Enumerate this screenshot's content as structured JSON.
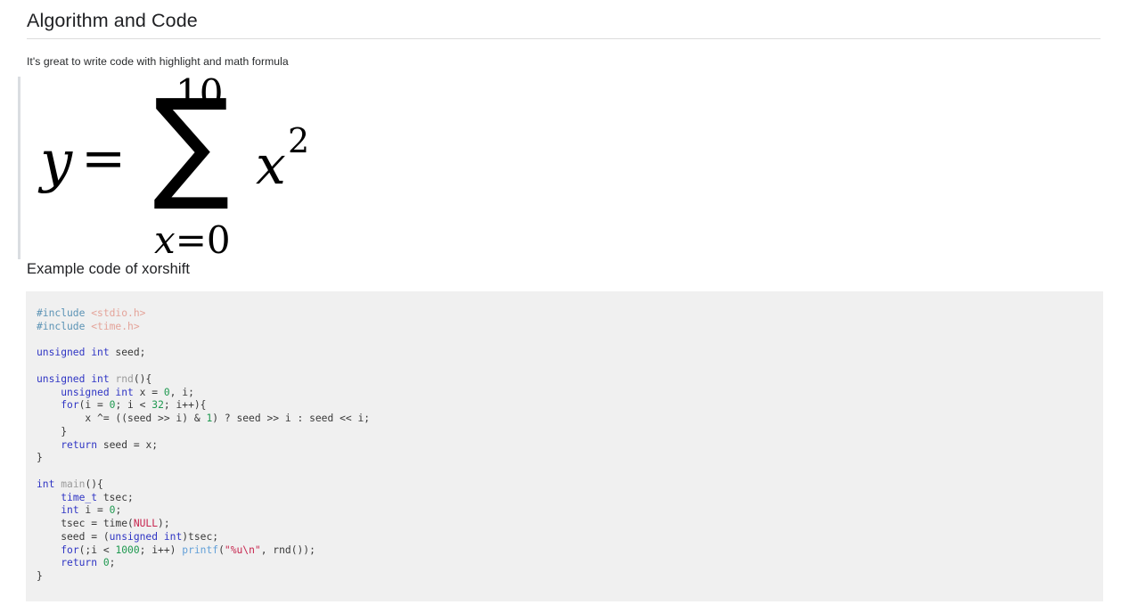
{
  "document": {
    "title": "Algorithm and Code",
    "intro": "It's great to write code with highlight and math formula",
    "sub_heading": "Example code of xorshift"
  },
  "formula": {
    "latex": "y = \\sum_{x=0}^{10} x^2",
    "plain": "y = sum from x=0 to 10 of x^2",
    "variable": "y",
    "equals": "=",
    "sigma": "∑",
    "upper_limit": "10",
    "lower_limit_var": "x",
    "lower_limit_eq": "=0",
    "term_base": "x",
    "term_exponent": "2"
  },
  "code_block": {
    "language": "c",
    "background": "#f0f0f0",
    "lines": [
      {
        "parts": [
          {
            "t": "#include ",
            "c": "pp"
          },
          {
            "t": "<stdio.h>",
            "c": "hd"
          }
        ]
      },
      {
        "parts": [
          {
            "t": "#include ",
            "c": "pp"
          },
          {
            "t": "<time.h>",
            "c": "hd"
          }
        ]
      },
      {
        "parts": [
          {
            "t": "",
            "c": "pl"
          }
        ]
      },
      {
        "parts": [
          {
            "t": "unsigned int",
            "c": "k"
          },
          {
            "t": " seed;",
            "c": "pl"
          }
        ]
      },
      {
        "parts": [
          {
            "t": "",
            "c": "pl"
          }
        ]
      },
      {
        "parts": [
          {
            "t": "unsigned int",
            "c": "k"
          },
          {
            "t": " ",
            "c": "pl"
          },
          {
            "t": "rnd",
            "c": "fn"
          },
          {
            "t": "(){",
            "c": "pl"
          }
        ]
      },
      {
        "parts": [
          {
            "t": "    ",
            "c": "pl"
          },
          {
            "t": "unsigned int",
            "c": "k"
          },
          {
            "t": " x = ",
            "c": "pl"
          },
          {
            "t": "0",
            "c": "n"
          },
          {
            "t": ", i;",
            "c": "pl"
          }
        ]
      },
      {
        "parts": [
          {
            "t": "    ",
            "c": "pl"
          },
          {
            "t": "for",
            "c": "k"
          },
          {
            "t": "(i = ",
            "c": "pl"
          },
          {
            "t": "0",
            "c": "n"
          },
          {
            "t": "; i < ",
            "c": "pl"
          },
          {
            "t": "32",
            "c": "n"
          },
          {
            "t": "; i++){",
            "c": "pl"
          }
        ]
      },
      {
        "parts": [
          {
            "t": "        x ^= ((seed >> i) & ",
            "c": "pl"
          },
          {
            "t": "1",
            "c": "n"
          },
          {
            "t": ") ? seed >> i : seed << i;",
            "c": "pl"
          }
        ]
      },
      {
        "parts": [
          {
            "t": "    }",
            "c": "pl"
          }
        ]
      },
      {
        "parts": [
          {
            "t": "    ",
            "c": "pl"
          },
          {
            "t": "return",
            "c": "k"
          },
          {
            "t": " seed = x;",
            "c": "pl"
          }
        ]
      },
      {
        "parts": [
          {
            "t": "}",
            "c": "pl"
          }
        ]
      },
      {
        "parts": [
          {
            "t": "",
            "c": "pl"
          }
        ]
      },
      {
        "parts": [
          {
            "t": "int",
            "c": "k"
          },
          {
            "t": " ",
            "c": "pl"
          },
          {
            "t": "main",
            "c": "fn"
          },
          {
            "t": "(){",
            "c": "pl"
          }
        ]
      },
      {
        "parts": [
          {
            "t": "    ",
            "c": "pl"
          },
          {
            "t": "time_t",
            "c": "k"
          },
          {
            "t": " tsec;",
            "c": "pl"
          }
        ]
      },
      {
        "parts": [
          {
            "t": "    ",
            "c": "pl"
          },
          {
            "t": "int",
            "c": "k"
          },
          {
            "t": " i = ",
            "c": "pl"
          },
          {
            "t": "0",
            "c": "n"
          },
          {
            "t": ";",
            "c": "pl"
          }
        ]
      },
      {
        "parts": [
          {
            "t": "    tsec = time(",
            "c": "pl"
          },
          {
            "t": "NULL",
            "c": "s"
          },
          {
            "t": ");",
            "c": "pl"
          }
        ]
      },
      {
        "parts": [
          {
            "t": "    seed = (",
            "c": "pl"
          },
          {
            "t": "unsigned int",
            "c": "k"
          },
          {
            "t": ")tsec;",
            "c": "pl"
          }
        ]
      },
      {
        "parts": [
          {
            "t": "    ",
            "c": "pl"
          },
          {
            "t": "for",
            "c": "k"
          },
          {
            "t": "(;i < ",
            "c": "pl"
          },
          {
            "t": "1000",
            "c": "n"
          },
          {
            "t": "; i++) ",
            "c": "pl"
          },
          {
            "t": "printf",
            "c": "bi"
          },
          {
            "t": "(",
            "c": "pl"
          },
          {
            "t": "\"%u\\n\"",
            "c": "s"
          },
          {
            "t": ", rnd());",
            "c": "pl"
          }
        ]
      },
      {
        "parts": [
          {
            "t": "    ",
            "c": "pl"
          },
          {
            "t": "return",
            "c": "k"
          },
          {
            "t": " ",
            "c": "pl"
          },
          {
            "t": "0",
            "c": "n"
          },
          {
            "t": ";",
            "c": "pl"
          }
        ]
      },
      {
        "parts": [
          {
            "t": "}",
            "c": "pl"
          }
        ]
      }
    ]
  },
  "colors": {
    "keyword": "#2f35c4",
    "number": "#1f9950",
    "string": "#c7254e",
    "function": "#9b9b9b",
    "preprocessor": "#5b93b5",
    "header_path": "#e4a49a",
    "builtin": "#62a0d8",
    "text": "#383838",
    "code_bg": "#f0f0f0",
    "rule": "#dcdcdc",
    "blockquote_border": "#dadde1"
  }
}
